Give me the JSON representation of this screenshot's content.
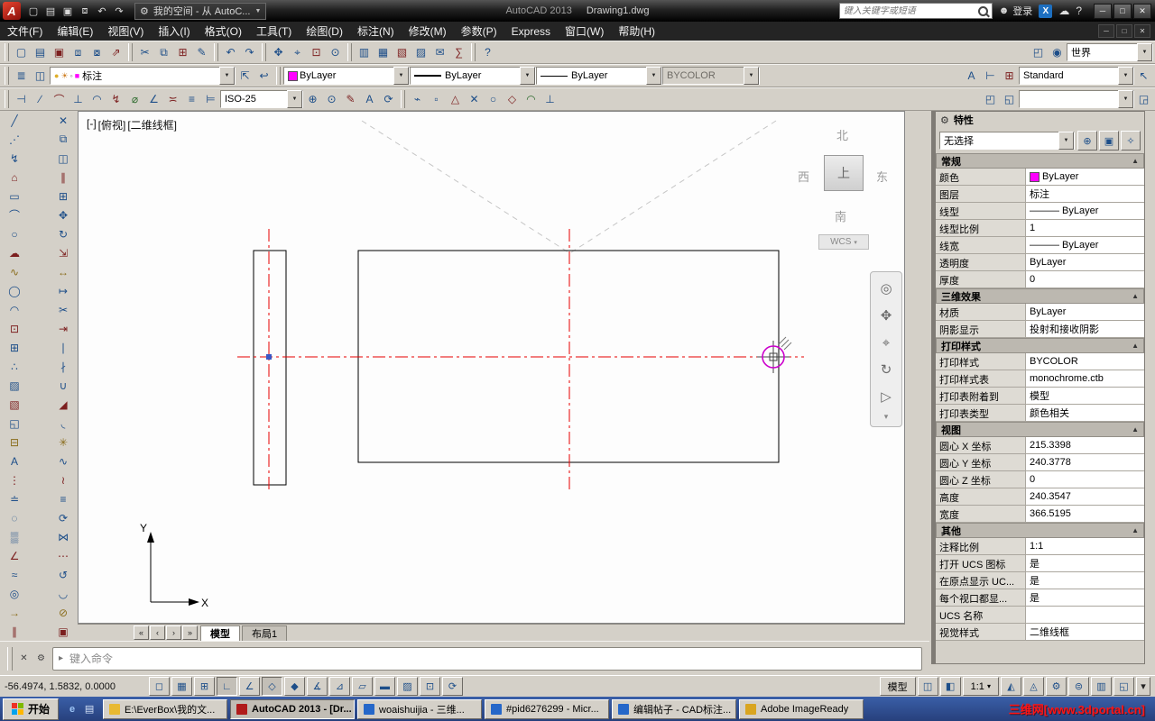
{
  "ui": {
    "logo_letter": "A",
    "arrow_down": "▼",
    "arrow_small": "▾",
    "collapse": "▲",
    "min": "─",
    "max": "□",
    "close": "✕",
    "gear": "⚙",
    "cloud": "☁",
    "help": "?",
    "x_logo": "X",
    "user": "☻",
    "prompt": "▸"
  },
  "titlebar": {
    "qat": [
      {
        "n": "qnew-icon",
        "g": "▢"
      },
      {
        "n": "open-icon",
        "g": "▤"
      },
      {
        "n": "save-icon",
        "g": "▣"
      },
      {
        "n": "plot-icon",
        "g": "⧈"
      },
      {
        "n": "undo-icon",
        "g": "↶"
      },
      {
        "n": "redo-icon",
        "g": "↷"
      }
    ],
    "workspace": "我的空间 - 从 AutoC...",
    "app_name": "AutoCAD 2013",
    "doc_name": "Drawing1.dwg",
    "search_placeholder": "键入关键字或短语",
    "signin": "登录"
  },
  "menubar": {
    "items": [
      {
        "label": "文件(F)",
        "name": "menu-file"
      },
      {
        "label": "编辑(E)",
        "name": "menu-edit"
      },
      {
        "label": "视图(V)",
        "name": "menu-view"
      },
      {
        "label": "插入(I)",
        "name": "menu-insert"
      },
      {
        "label": "格式(O)",
        "name": "menu-format"
      },
      {
        "label": "工具(T)",
        "name": "menu-tools"
      },
      {
        "label": "绘图(D)",
        "name": "menu-draw"
      },
      {
        "label": "标注(N)",
        "name": "menu-dimension"
      },
      {
        "label": "修改(M)",
        "name": "menu-modify"
      },
      {
        "label": "参数(P)",
        "name": "menu-parametric"
      },
      {
        "label": "Express",
        "name": "menu-express"
      },
      {
        "label": "窗口(W)",
        "name": "menu-window"
      },
      {
        "label": "帮助(H)",
        "name": "menu-help"
      }
    ]
  },
  "toolbar1": {
    "g1": [
      {
        "n": "qnew-icon",
        "g": "▢"
      },
      {
        "n": "open-icon",
        "g": "▤"
      },
      {
        "n": "save-icon",
        "g": "▣"
      },
      {
        "n": "plot-icon",
        "g": "⧈"
      },
      {
        "n": "plot-preview-icon",
        "g": "⧇"
      },
      {
        "n": "publish-icon",
        "g": "⇗"
      }
    ],
    "g2": [
      {
        "n": "cut-icon",
        "g": "✂"
      },
      {
        "n": "copy-icon",
        "g": "⧉"
      },
      {
        "n": "paste-icon",
        "g": "⊞"
      },
      {
        "n": "match-properties-icon",
        "g": "✎"
      }
    ],
    "g3": [
      {
        "n": "undo-icon",
        "g": "↶"
      },
      {
        "n": "redo-icon",
        "g": "↷"
      }
    ],
    "g4": [
      {
        "n": "pan-icon",
        "g": "✥"
      },
      {
        "n": "zoom-realtime-icon",
        "g": "⌖"
      },
      {
        "n": "zoom-window-icon",
        "g": "⊡"
      },
      {
        "n": "zoom-previous-icon",
        "g": "⊙"
      }
    ],
    "g5": [
      {
        "n": "properties-icon",
        "g": "▥"
      },
      {
        "n": "designcenter-icon",
        "g": "▦"
      },
      {
        "n": "tool-palettes-icon",
        "g": "▧"
      },
      {
        "n": "sheet-set-manager-icon",
        "g": "▨"
      },
      {
        "n": "markup-icon",
        "g": "✉"
      },
      {
        "n": "quickcalc-icon",
        "g": "∑"
      }
    ],
    "g6": [
      {
        "n": "help-icon",
        "g": "?"
      }
    ],
    "g7": [
      {
        "n": "named-ucs-icon",
        "g": "◰"
      },
      {
        "n": "world-globe-icon",
        "g": "◉"
      }
    ],
    "wcs_label": "世界"
  },
  "toolbar2": {
    "g1": [
      {
        "n": "layer-properties-icon",
        "g": "≣"
      },
      {
        "n": "layer-states-icon",
        "g": "◫"
      }
    ],
    "layer_icons": [
      {
        "n": "layer-on-icon",
        "g": "●",
        "c": "#dfae2a"
      },
      {
        "n": "layer-freeze-icon",
        "g": "☀",
        "c": "#cf7f23"
      },
      {
        "n": "layer-lock-icon",
        "g": "◦",
        "c": "#666666"
      },
      {
        "n": "layer-color-icon",
        "g": "■",
        "c": "#ff00ff"
      }
    ],
    "layer_value": "标注",
    "g2": [
      {
        "n": "make-object-layer-current-icon",
        "g": "⇱"
      },
      {
        "n": "layer-previous-icon",
        "g": "↩"
      }
    ],
    "color_value": "ByLayer",
    "color_swatch": "#ff00ff",
    "linetype_value": "ByLayer",
    "lineweight_value": "ByLayer",
    "plotstyle_value": "BYCOLOR",
    "g3": [
      {
        "n": "text-style-icon",
        "g": "A"
      },
      {
        "n": "dimension-style-icon",
        "g": "⊢"
      },
      {
        "n": "table-style-icon",
        "g": "⊞"
      }
    ],
    "textstyle_value": "Standard",
    "g4": [
      {
        "n": "multileader-style-icon",
        "g": "↖"
      }
    ]
  },
  "toolbar3": {
    "g1": [
      {
        "n": "linear-dimension-icon",
        "g": "⊣"
      },
      {
        "n": "aligned-dimension-icon",
        "g": "∕"
      },
      {
        "n": "arc-length-icon",
        "g": "⌒"
      },
      {
        "n": "ordinate-icon",
        "g": "⊥"
      },
      {
        "n": "radius-icon",
        "g": "◠"
      },
      {
        "n": "jogged-icon",
        "g": "↯"
      },
      {
        "n": "diameter-icon",
        "g": "⌀"
      },
      {
        "n": "angular-icon",
        "g": "∠"
      },
      {
        "n": "quick-dim-icon",
        "g": "≍"
      },
      {
        "n": "baseline-icon",
        "g": "≡"
      },
      {
        "n": "continue-icon",
        "g": "⊨"
      }
    ],
    "dimstyle_value": "ISO-25",
    "g2": [
      {
        "n": "tolerance-icon",
        "g": "⊕"
      },
      {
        "n": "center-mark-icon",
        "g": "⊙"
      },
      {
        "n": "dim-edit-icon",
        "g": "✎"
      },
      {
        "n": "dim-text-edit-icon",
        "g": "A"
      },
      {
        "n": "dim-update-icon",
        "g": "⟳"
      }
    ],
    "g3": [
      {
        "n": "snap-from-icon",
        "g": "⌁"
      },
      {
        "n": "snap-endpoint-icon",
        "g": "▫"
      },
      {
        "n": "snap-midpoint-icon",
        "g": "△"
      },
      {
        "n": "snap-intersection-icon",
        "g": "✕"
      },
      {
        "n": "snap-center-icon",
        "g": "○"
      },
      {
        "n": "snap-quadrant-icon",
        "g": "◇"
      },
      {
        "n": "snap-tangent-icon",
        "g": "◠"
      },
      {
        "n": "snap-perpendicular-icon",
        "g": "⊥"
      }
    ],
    "g4": [
      {
        "n": "view-prev-icon",
        "g": "◰"
      },
      {
        "n": "view-next-icon",
        "g": "◱"
      }
    ],
    "combo2_value": "",
    "g5": [
      {
        "n": "view-manager-icon",
        "g": "◲"
      }
    ]
  },
  "lefttools": {
    "col1": [
      {
        "n": "line-icon",
        "g": "╱"
      },
      {
        "n": "construction-line-icon",
        "g": "⋰"
      },
      {
        "n": "polyline-icon",
        "g": "↯"
      },
      {
        "n": "polygon-icon",
        "g": "⌂"
      },
      {
        "n": "rectangle-icon",
        "g": "▭"
      },
      {
        "n": "arc-icon",
        "g": "⌒"
      },
      {
        "n": "circle-icon",
        "g": "○"
      },
      {
        "n": "revision-cloud-icon",
        "g": "☁"
      },
      {
        "n": "spline-icon",
        "g": "∿"
      },
      {
        "n": "ellipse-icon",
        "g": "◯"
      },
      {
        "n": "ellipse-arc-icon",
        "g": "◠"
      },
      {
        "n": "insert-block-icon",
        "g": "⊡"
      },
      {
        "n": "make-block-icon",
        "g": "⊞"
      },
      {
        "n": "point-icon",
        "g": "∴"
      },
      {
        "n": "hatch-icon",
        "g": "▨"
      },
      {
        "n": "gradient-icon",
        "g": "▧"
      },
      {
        "n": "region-icon",
        "g": "◱"
      },
      {
        "n": "table-icon",
        "g": "⊟"
      },
      {
        "n": "mtext-icon",
        "g": "A"
      },
      {
        "n": "divide-icon",
        "g": "⋮"
      },
      {
        "n": "measure-icon",
        "g": "≐"
      },
      {
        "n": "boundary-icon",
        "g": "◌"
      },
      {
        "n": "wipeout-icon",
        "g": "▒"
      },
      {
        "n": "3d-polyline-icon",
        "g": "∠"
      },
      {
        "n": "helix-icon",
        "g": "≈"
      },
      {
        "n": "donut-icon",
        "g": "◎"
      },
      {
        "n": "ray-icon",
        "g": "→"
      },
      {
        "n": "multiline-icon",
        "g": "∥"
      }
    ],
    "col2": [
      {
        "n": "erase-icon",
        "g": "✕"
      },
      {
        "n": "copy-object-icon",
        "g": "⧉"
      },
      {
        "n": "mirror-icon",
        "g": "◫"
      },
      {
        "n": "offset-icon",
        "g": "∥"
      },
      {
        "n": "array-icon",
        "g": "⊞"
      },
      {
        "n": "move-icon",
        "g": "✥"
      },
      {
        "n": "rotate-icon",
        "g": "↻"
      },
      {
        "n": "scale-icon",
        "g": "⇲"
      },
      {
        "n": "stretch-icon",
        "g": "↔"
      },
      {
        "n": "lengthen-icon",
        "g": "↦"
      },
      {
        "n": "trim-icon",
        "g": "✂"
      },
      {
        "n": "extend-icon",
        "g": "⇥"
      },
      {
        "n": "break-at-point-icon",
        "g": "∣"
      },
      {
        "n": "break-icon",
        "g": "∤"
      },
      {
        "n": "join-icon",
        "g": "∪"
      },
      {
        "n": "chamfer-icon",
        "g": "◢"
      },
      {
        "n": "fillet-icon",
        "g": "◟"
      },
      {
        "n": "explode-icon",
        "g": "✳"
      },
      {
        "n": "pedit-icon",
        "g": "∿"
      },
      {
        "n": "spline-edit-icon",
        "g": "≀"
      },
      {
        "n": "align-icon",
        "g": "≡"
      },
      {
        "n": "3d-rotate-icon",
        "g": "⟳"
      },
      {
        "n": "mirror3d-icon",
        "g": "⋈"
      },
      {
        "n": "array-path-icon",
        "g": "⋯"
      },
      {
        "n": "reverse-icon",
        "g": "↺"
      },
      {
        "n": "blend-icon",
        "g": "◡"
      },
      {
        "n": "overkill-icon",
        "g": "⊘"
      },
      {
        "n": "group-icon",
        "g": "▣"
      }
    ]
  },
  "canvas": {
    "viewport_controls": "[-]",
    "viewport_view": "[俯视]",
    "viewport_style": "[二维线框]",
    "viewcube": {
      "north": "北",
      "south": "南",
      "east": "东",
      "west": "西",
      "top": "上",
      "wcs": "WCS"
    },
    "ucs_x": "X",
    "ucs_y": "Y",
    "navbar": [
      {
        "n": "navigation-wheel-icon",
        "g": "◎"
      },
      {
        "n": "pan-hand-icon",
        "g": "✥"
      },
      {
        "n": "zoom-extents-icon",
        "g": "⌖"
      },
      {
        "n": "orbit-icon",
        "g": "↻"
      },
      {
        "n": "show-motion-icon",
        "g": "▷"
      }
    ],
    "tab_nav": [
      "«",
      "‹",
      "›",
      "»"
    ],
    "tabs": [
      {
        "label": "模型",
        "name": "tab-model",
        "cls": "active"
      },
      {
        "label": "布局1",
        "name": "tab-layout1"
      }
    ]
  },
  "commandline": {
    "icons": [
      {
        "n": "close-icon",
        "g": "✕"
      },
      {
        "n": "customize-icon",
        "g": "⚙"
      }
    ],
    "placeholder": "键入命令"
  },
  "statusbar": {
    "coords": "-56.4974, 1.5832, 0.0000",
    "toggles": [
      {
        "n": "infer-constraints-icon",
        "g": "◻"
      },
      {
        "n": "snap-mode-icon",
        "g": "▦"
      },
      {
        "n": "grid-display-icon",
        "g": "⊞"
      },
      {
        "n": "ortho-mode-icon",
        "g": "∟",
        "cls": "on"
      },
      {
        "n": "polar-tracking-icon",
        "g": "∠"
      },
      {
        "n": "object-snap-icon",
        "g": "◇",
        "cls": "on"
      },
      {
        "n": "3d-object-snap-icon",
        "g": "◆"
      },
      {
        "n": "object-snap-tracking-icon",
        "g": "∡"
      },
      {
        "n": "dynamic-ucs-icon",
        "g": "⊿"
      },
      {
        "n": "dynamic-input-icon",
        "g": "▱"
      },
      {
        "n": "lineweight-display-icon",
        "g": "▬"
      },
      {
        "n": "transparency-icon",
        "g": "▨"
      },
      {
        "n": "quick-properties-icon",
        "g": "⊡"
      },
      {
        "n": "selection-cycling-icon",
        "g": "⟳"
      }
    ],
    "model_label": "模型",
    "icons1": [
      {
        "n": "quick-view-layouts-icon",
        "g": "◫"
      },
      {
        "n": "quick-view-drawings-icon",
        "g": "◧"
      }
    ],
    "scale": "1:1",
    "icons2": [
      {
        "n": "annotation-visibility-icon",
        "g": "◭"
      },
      {
        "n": "annotation-autoscale-icon",
        "g": "◬"
      },
      {
        "n": "workspace-switching-icon",
        "g": "⚙"
      },
      {
        "n": "toolbar-lock-icon",
        "g": "⊜"
      },
      {
        "n": "hardware-accel-icon",
        "g": "▥"
      },
      {
        "n": "clean-screen-icon",
        "g": "◱"
      }
    ]
  },
  "taskbar": {
    "start": "开始",
    "quick": [
      {
        "n": "quicklaunch-ie-icon",
        "g": "e",
        "c": "#9cc4f5"
      },
      {
        "n": "quicklaunch-desktop-icon",
        "g": "▤",
        "c": "#d8e4f8"
      }
    ],
    "items": [
      {
        "label": "E:\\EverBox\\我的文...",
        "c": "#e8b931",
        "name": "taskbar-item-explorer"
      },
      {
        "label": "AutoCAD 2013 - [Dr...",
        "c": "#b01b1b",
        "cls": "active",
        "name": "taskbar-item-autocad"
      },
      {
        "label": "woaishuijia - 三维...",
        "c": "#2567c9",
        "name": "taskbar-item-browser1"
      },
      {
        "label": "#pid6276299 - Micr...",
        "c": "#2567c9",
        "name": "taskbar-item-browser2"
      },
      {
        "label": "编辑帖子 - CAD标注...",
        "c": "#2567c9",
        "name": "taskbar-item-browser3"
      },
      {
        "label": "Adobe ImageReady",
        "c": "#d9a520",
        "name": "taskbar-item-imageready"
      }
    ],
    "watermark": "三维网[www.3dportal.cn]"
  },
  "properties": {
    "title": "特性",
    "selection": "无选择",
    "buttons": [
      {
        "n": "toggle-pickadd-icon",
        "g": "⊕"
      },
      {
        "n": "select-objects-icon",
        "g": "▣"
      },
      {
        "n": "quick-select-icon",
        "g": "✧"
      }
    ],
    "s1": {
      "title": "常规",
      "rows": [
        {
          "label": "颜色",
          "value": "ByLayer",
          "swatch": "#ff00ff"
        },
        {
          "label": "图层",
          "value": "标注"
        },
        {
          "label": "线型",
          "value": "――― ByLayer"
        },
        {
          "label": "线型比例",
          "value": "1"
        },
        {
          "label": "线宽",
          "value": "――― ByLayer"
        },
        {
          "label": "透明度",
          "value": "ByLayer"
        },
        {
          "label": "厚度",
          "value": "0"
        }
      ]
    },
    "s2": {
      "title": "三维效果",
      "rows": [
        {
          "label": "材质",
          "value": "ByLayer"
        },
        {
          "label": "阴影显示",
          "value": "投射和接收阴影"
        }
      ]
    },
    "s3": {
      "title": "打印样式",
      "rows": [
        {
          "label": "打印样式",
          "value": "BYCOLOR"
        },
        {
          "label": "打印样式表",
          "value": "monochrome.ctb"
        },
        {
          "label": "打印表附着到",
          "value": "模型"
        },
        {
          "label": "打印表类型",
          "value": "颜色相关"
        }
      ]
    },
    "s4": {
      "title": "视图",
      "rows": [
        {
          "label": "圆心 X 坐标",
          "value": "215.3398"
        },
        {
          "label": "圆心 Y 坐标",
          "value": "240.3778"
        },
        {
          "label": "圆心 Z 坐标",
          "value": "0"
        },
        {
          "label": "高度",
          "value": "240.3547"
        },
        {
          "label": "宽度",
          "value": "366.5195"
        }
      ]
    },
    "s5": {
      "title": "其他",
      "rows": [
        {
          "label": "注释比例",
          "value": "1:1"
        },
        {
          "label": "打开 UCS 图标",
          "value": "是"
        },
        {
          "label": "在原点显示 UC...",
          "value": "是"
        },
        {
          "label": "每个视口都显...",
          "value": "是"
        },
        {
          "label": "UCS 名称",
          "value": ""
        },
        {
          "label": "视觉样式",
          "value": "二维线框"
        }
      ]
    }
  }
}
